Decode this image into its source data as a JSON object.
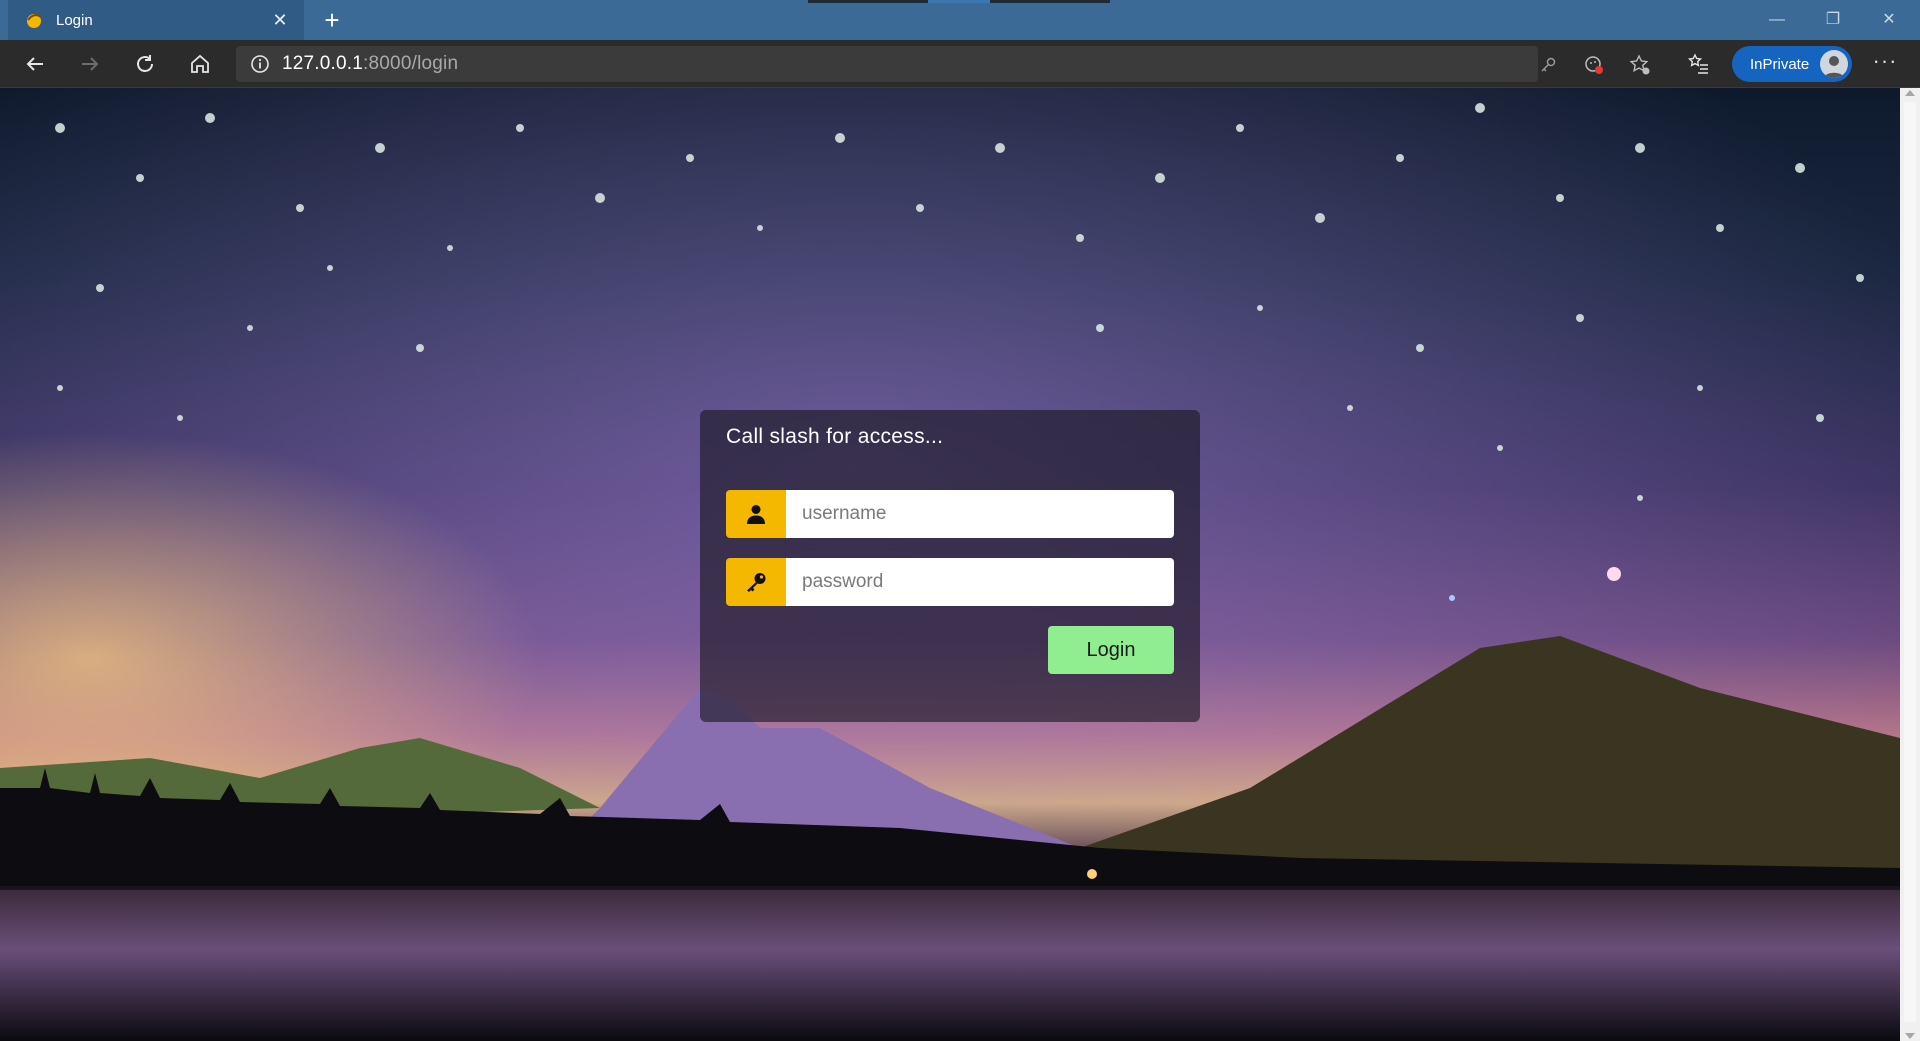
{
  "browser": {
    "tab_title": "Login",
    "url_host": "127.0.0.1",
    "url_rest": ":8000/login",
    "inprivate_label": "InPrivate"
  },
  "login": {
    "title": "Call slash for access...",
    "username_placeholder": "username",
    "password_placeholder": "password",
    "button_label": "Login",
    "accent_color": "#f5b800",
    "button_color": "#90ee90"
  }
}
